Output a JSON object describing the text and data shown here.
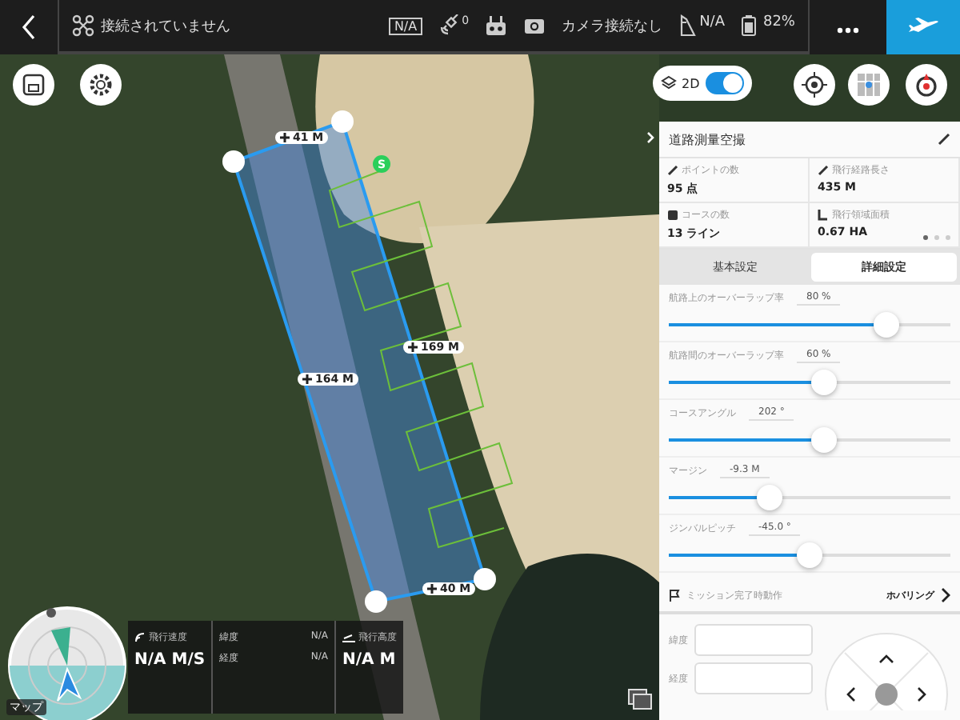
{
  "status_bar": {
    "connection": "接続されていません",
    "signal": "N/A",
    "satellites": "0",
    "camera": "カメラ接続なし",
    "rtk": "N/A",
    "battery": "82%"
  },
  "map": {
    "view_mode": {
      "label": "2D",
      "on": true
    },
    "start_marker": "S",
    "distances": [
      {
        "label": "41 M"
      },
      {
        "label": "164 M"
      },
      {
        "label": "169 M"
      },
      {
        "label": "40 M"
      }
    ]
  },
  "telemetry": {
    "map_label": "マップ",
    "speed": {
      "label": "飛行速度",
      "value": "N/A M/S"
    },
    "coords": [
      {
        "label": "緯度",
        "value": "N/A"
      },
      {
        "label": "経度",
        "value": "N/A"
      }
    ],
    "altitude": {
      "label": "飛行高度",
      "value": "N/A M"
    }
  },
  "panel": {
    "title": "道路測量空撮",
    "stats": [
      {
        "label": "ポイントの数",
        "value": "95 点"
      },
      {
        "label": "飛行経路長さ",
        "value": "435 M"
      },
      {
        "label": "コースの数",
        "value": "13 ライン"
      },
      {
        "label": "飛行領域面積",
        "value": "0.67 HA"
      }
    ],
    "pages": [
      {
        "selected": true
      },
      {
        "selected": false
      },
      {
        "selected": false
      }
    ],
    "tabs": [
      {
        "label": "基本設定",
        "selected": false
      },
      {
        "label": "詳細設定",
        "selected": true
      }
    ],
    "sliders": [
      {
        "label": "航路上のオーバーラップ率",
        "reading": "80 %",
        "level": 0.77
      },
      {
        "label": "航路間のオーバーラップ率",
        "reading": "60 %",
        "level": 0.55
      },
      {
        "label": "コースアングル",
        "reading": "202 °",
        "level": 0.55
      },
      {
        "label": "マージン",
        "reading": "-9.3 M",
        "level": 0.36
      },
      {
        "label": "ジンバルピッチ",
        "reading": "-45.0 °",
        "level": 0.5
      }
    ],
    "finish_action": {
      "label": "ミッション完了時動作",
      "value": "ホバリング"
    },
    "fields": [
      {
        "label": "緯度"
      },
      {
        "label": "経度"
      }
    ]
  }
}
